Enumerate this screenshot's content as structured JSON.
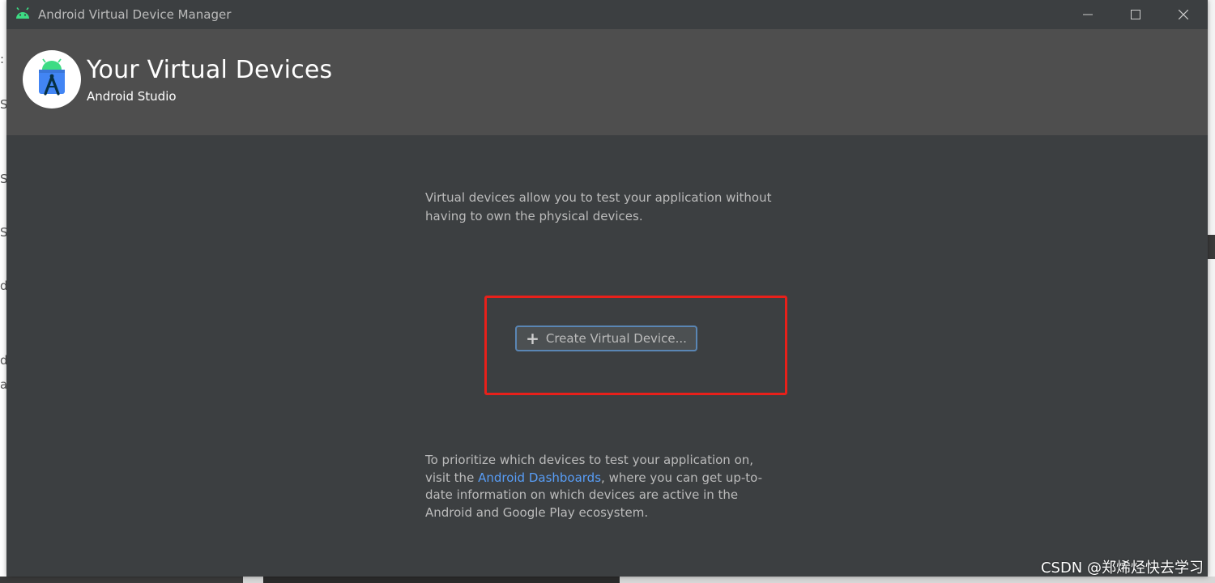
{
  "window": {
    "title": "Android Virtual Device Manager"
  },
  "header": {
    "title": "Your Virtual Devices",
    "subtitle": "Android Studio"
  },
  "content": {
    "intro": "Virtual devices allow you to test your application without having to own the physical devices.",
    "create_button_label": "Create Virtual Device...",
    "outro_before": "To prioritize which devices to test your application on, visit the ",
    "outro_link": "Android Dashboards",
    "outro_after": ", where you can get up-to-date information on which devices are active in the Android and Google Play ecosystem."
  },
  "watermark": "CSDN @郑烯烃快去学习",
  "colors": {
    "window_bg": "#3c3f41",
    "header_bg": "#4e4e4e",
    "link": "#589df6",
    "highlight": "#e8201a",
    "button_border": "#5a86b4"
  },
  "icons": [
    "android-icon",
    "minimize-icon",
    "maximize-icon",
    "close-icon",
    "android-studio-logo",
    "plus-icon"
  ]
}
